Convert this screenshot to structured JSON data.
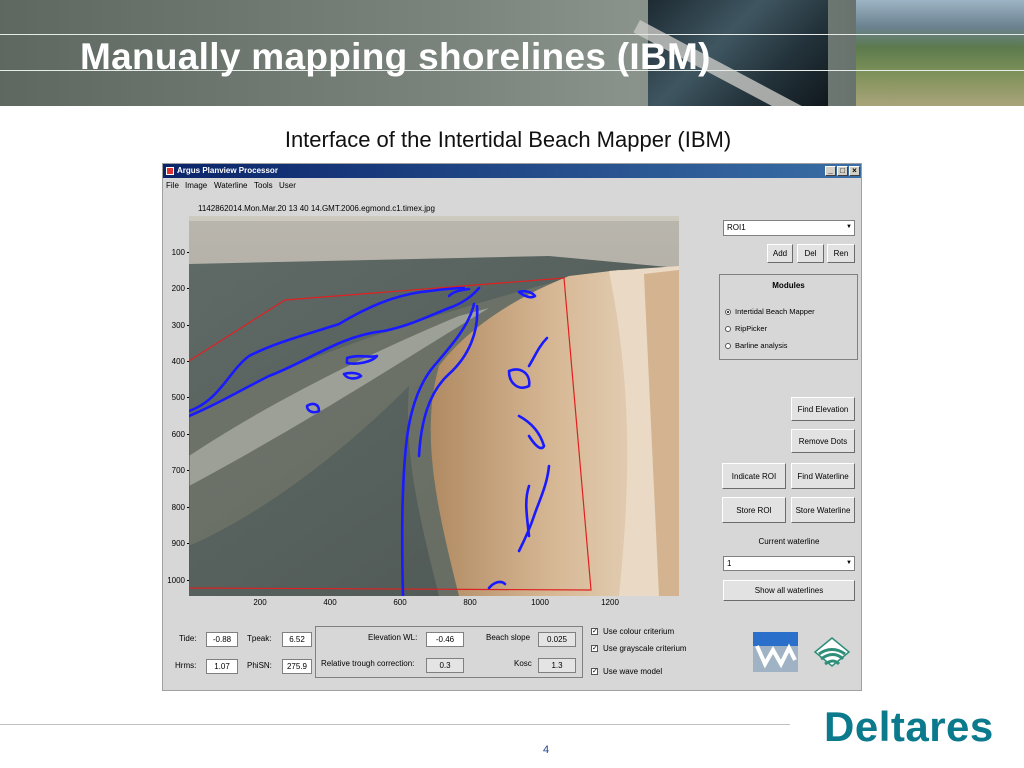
{
  "slide": {
    "title": "Manually mapping shorelines (IBM)",
    "subtitle": "Interface of the Intertidal Beach Mapper (IBM)",
    "page_number": "4",
    "logo_text": "Deltares"
  },
  "window": {
    "title": "Argus Planview Processor",
    "controls": [
      "_",
      "□",
      "×"
    ],
    "menu": [
      "File",
      "Image",
      "Waterline",
      "Tools",
      "User"
    ]
  },
  "image": {
    "filename": "1142862014.Mon.Mar.20 13 40 14.GMT.2006.egmond.c1.timex.jpg",
    "y_ticks": [
      "100",
      "200",
      "300",
      "400",
      "500",
      "600",
      "700",
      "800",
      "900",
      "1000"
    ],
    "x_ticks": [
      "200",
      "400",
      "600",
      "800",
      "1000",
      "1200"
    ],
    "shoreline_color": "#1a1aff",
    "roi_color": "#e02020"
  },
  "right_panel": {
    "roi_select": "ROI1",
    "add_label": "Add",
    "del_label": "Del",
    "ren_label": "Ren",
    "modules_title": "Modules",
    "modules": [
      {
        "label": "Intertidal Beach Mapper",
        "selected": true
      },
      {
        "label": "RipPicker",
        "selected": false
      },
      {
        "label": "Barline analysis",
        "selected": false
      }
    ],
    "find_elevation": "Find Elevation",
    "remove_dots": "Remove Dots",
    "indicate_roi": "Indicate ROI",
    "find_waterline": "Find Waterline",
    "store_roi": "Store ROI",
    "store_waterline": "Store Waterline",
    "current_waterline_label": "Current waterline",
    "current_waterline_value": "1",
    "show_all": "Show all waterlines"
  },
  "params": {
    "tide_label": "Tide:",
    "tide": "-0.88",
    "hrms_label": "Hrms:",
    "hrms": "1.07",
    "tpeak_label": "Tpeak:",
    "tpeak": "6.52",
    "phisn_label": "PhiSN:",
    "phisn": "275.9",
    "elev_label": "Elevation WL:",
    "elev": "-0.46",
    "beach_slope_label": "Beach slope",
    "beach_slope": "0.025",
    "rtc_label": "Relative trough correction:",
    "rtc": "0.3",
    "kosc_label": "Kosc",
    "kosc": "1.3"
  },
  "criteria": [
    {
      "label": "Use colour criterium",
      "checked": true
    },
    {
      "label": "Use grayscale criterium",
      "checked": true
    },
    {
      "label": "Use wave model",
      "checked": true
    }
  ]
}
